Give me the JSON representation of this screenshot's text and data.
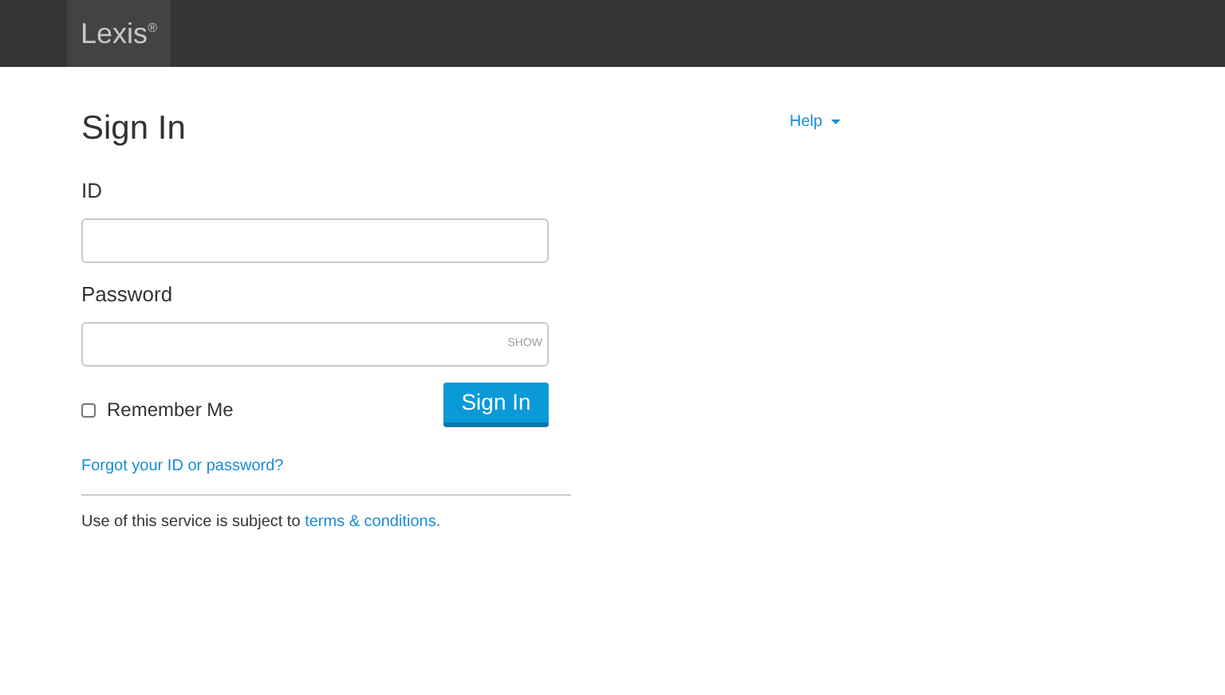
{
  "header": {
    "logo": "Lexis",
    "logo_mark": "®"
  },
  "title": "Sign In",
  "help": {
    "label": "Help"
  },
  "id_field": {
    "label": "ID"
  },
  "password_field": {
    "label": "Password",
    "toggle": "SHOW"
  },
  "remember_me": {
    "label": "Remember Me",
    "checked": false
  },
  "sign_in_button": "Sign In",
  "forgot_link": "Forgot your ID or password?",
  "terms": {
    "text": "Use of this service is subject to",
    "link": "terms & conditions."
  }
}
